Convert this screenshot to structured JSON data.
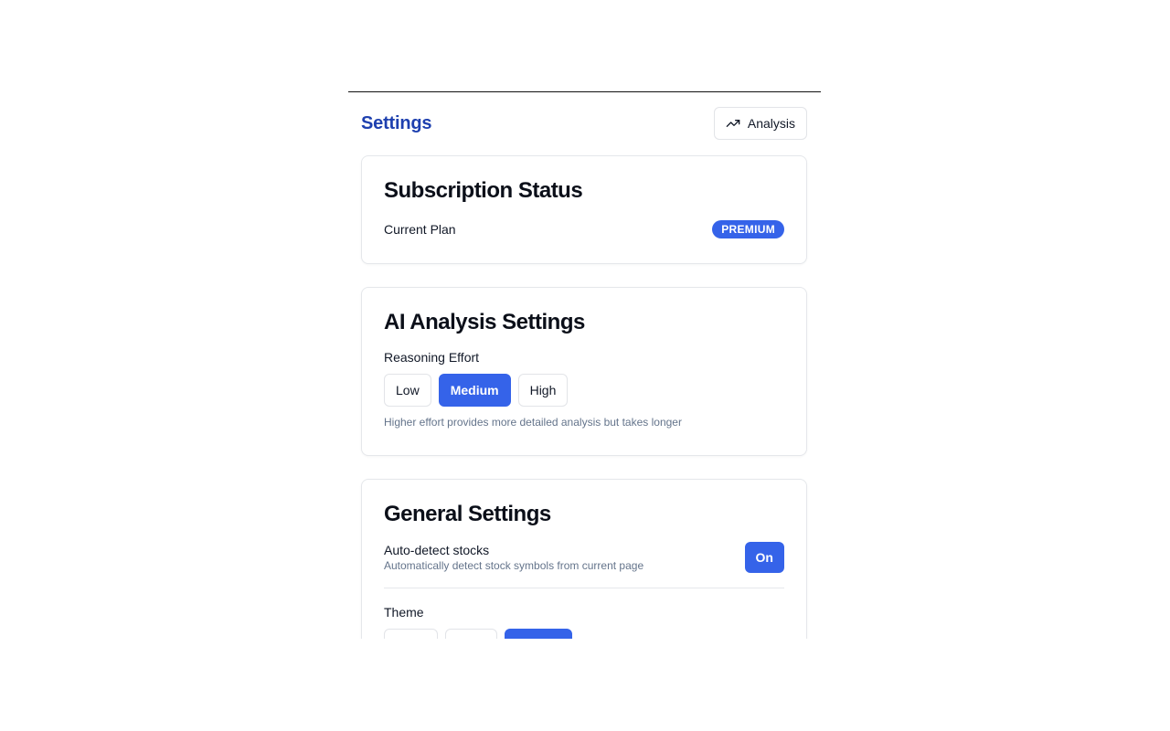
{
  "header": {
    "title": "Settings",
    "analysis_button": {
      "label": "Analysis",
      "icon": "trending-up-icon"
    }
  },
  "subscription": {
    "title": "Subscription Status",
    "plan_label": "Current Plan",
    "plan_badge": "PREMIUM"
  },
  "ai_settings": {
    "title": "AI Analysis Settings",
    "reasoning_label": "Reasoning Effort",
    "options": [
      "Low",
      "Medium",
      "High"
    ],
    "selected": "Medium",
    "hint": "Higher effort provides more detailed analysis but takes longer"
  },
  "general": {
    "title": "General Settings",
    "auto_detect": {
      "label": "Auto-detect stocks",
      "description": "Automatically detect stock symbols from current page",
      "toggle_label": "On"
    },
    "theme": {
      "label": "Theme",
      "selected_index": 2
    }
  },
  "colors": {
    "accent": "#3563e9",
    "title": "#1e40af",
    "muted": "#64748b",
    "border": "#e5e7eb"
  }
}
